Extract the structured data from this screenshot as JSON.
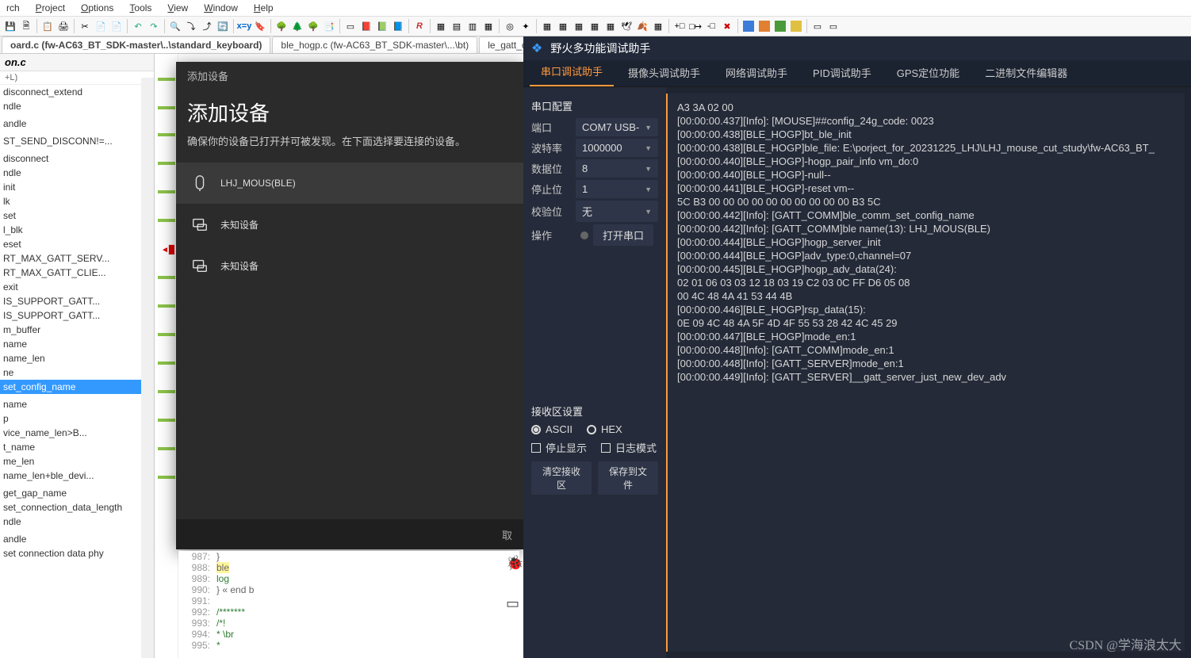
{
  "menu": {
    "search": "rch",
    "project": "Project",
    "options": "Options",
    "tools": "Tools",
    "view": "View",
    "window": "Window",
    "help": "Help"
  },
  "tabs": {
    "t1": "oard.c (fw-AC63_BT_SDK-master\\..\\standard_keyboard)",
    "t2": "ble_hogp.c (fw-AC63_BT_SDK-master\\...\\bt)",
    "t3": "le_gatt_co"
  },
  "outline": {
    "title": "on.c",
    "sub": "+L)",
    "items": [
      "disconnect_extend",
      "ndle",
      "",
      "andle",
      "",
      "ST_SEND_DISCONN!=...",
      "",
      "disconnect",
      "ndle",
      "init",
      "lk",
      "set",
      "l_blk",
      "eset",
      "RT_MAX_GATT_SERV...",
      "RT_MAX_GATT_CLIE...",
      "exit",
      "IS_SUPPORT_GATT...",
      "IS_SUPPORT_GATT...",
      "m_buffer",
      "name",
      "name_len",
      "ne",
      "set_config_name",
      "",
      "name",
      "p",
      "vice_name_len>B...",
      "t_name",
      "me_len",
      "name_len+ble_devi...",
      "",
      "get_gap_name",
      "set_connection_data_length",
      "ndle",
      "",
      "andle",
      "set connection data phy"
    ],
    "selected_index": 23
  },
  "dialog": {
    "header": "添加设备",
    "title": "添加设备",
    "tip": "确保你的设备已打开并可被发现。在下面选择要连接的设备。",
    "devices": [
      "LHJ_MOUS(BLE)",
      "未知设备",
      "未知设备"
    ],
    "cancel_prefix": "取"
  },
  "code": {
    "lines": [
      {
        "n": "987:",
        "t": "}"
      },
      {
        "n": "988:",
        "t": "ble",
        "cls": "hl-y"
      },
      {
        "n": "989:",
        "t": "log",
        "cls": "g"
      },
      {
        "n": "990:",
        "t": "} « end b"
      },
      {
        "n": "991:",
        "t": ""
      },
      {
        "n": "992:",
        "t": "/*******",
        "cls": "g"
      },
      {
        "n": "993:",
        "t": "/*!",
        "cls": "g"
      },
      {
        "n": "994:",
        "t": " *   \\br",
        "cls": "g"
      },
      {
        "n": "995:",
        "t": " *",
        "cls": "g"
      }
    ]
  },
  "rightapp": {
    "title": "野火多功能调试助手",
    "tabs": [
      "串口调试助手",
      "摄像头调试助手",
      "网络调试助手",
      "PID调试助手",
      "GPS定位功能",
      "二进制文件编辑器"
    ],
    "active_tab": 0,
    "cfg_title": "串口配置",
    "cfg": {
      "port_lbl": "端口",
      "port_val": "COM7 USB-",
      "baud_lbl": "波特率",
      "baud_val": "1000000",
      "data_lbl": "数据位",
      "data_val": "8",
      "stop_lbl": "停止位",
      "stop_val": "1",
      "chk_lbl": "校验位",
      "chk_val": "无",
      "op_lbl": "操作",
      "open_btn": "打开串口"
    },
    "recv_title": "接收区设置",
    "ascii": "ASCII",
    "hex": "HEX",
    "stop_disp": "停止显示",
    "log_mode": "日志模式",
    "clear_btn": "清空接收区",
    "save_btn": "保存到文件",
    "log": [
      "A3 3A 02 00",
      "[00:00:00.437][Info]: [MOUSE]##config_24g_code: 0023",
      "[00:00:00.438][BLE_HOGP]bt_ble_init",
      "",
      "[00:00:00.438][BLE_HOGP]ble_file: E:\\porject_for_20231225_LHJ\\LHJ_mouse_cut_study\\fw-AC63_BT_",
      "[00:00:00.440][BLE_HOGP]-hogp_pair_info vm_do:0",
      "",
      "[00:00:00.440][BLE_HOGP]-null--",
      "",
      "[00:00:00.441][BLE_HOGP]-reset vm--",
      "",
      "5C B3 00 00 00 00 00 00 00 00 00 00 B3 5C",
      "[00:00:00.442][Info]: [GATT_COMM]ble_comm_set_config_name",
      "",
      "[00:00:00.442][Info]: [GATT_COMM]ble name(13): LHJ_MOUS(BLE)",
      "",
      "[00:00:00.444][BLE_HOGP]hogp_server_init",
      "[00:00:00.444][BLE_HOGP]adv_type:0,channel=07",
      "",
      "[00:00:00.445][BLE_HOGP]hogp_adv_data(24):",
      "02 01 06 03 03 12 18 03 19 C2 03 0C FF D6 05 08",
      "00 4C 48 4A 41 53 44 4B",
      "[00:00:00.446][BLE_HOGP]rsp_data(15):",
      "0E 09 4C 48 4A 5F 4D 4F 55 53 28 42 4C 45 29",
      "[00:00:00.447][BLE_HOGP]mode_en:1",
      "",
      "[00:00:00.448][Info]: [GATT_COMM]mode_en:1",
      "",
      "[00:00:00.448][Info]: [GATT_SERVER]mode_en:1",
      "",
      "[00:00:00.449][Info]: [GATT_SERVER]__gatt_server_just_new_dev_adv"
    ]
  },
  "watermark": "CSDN @学海浪太大"
}
